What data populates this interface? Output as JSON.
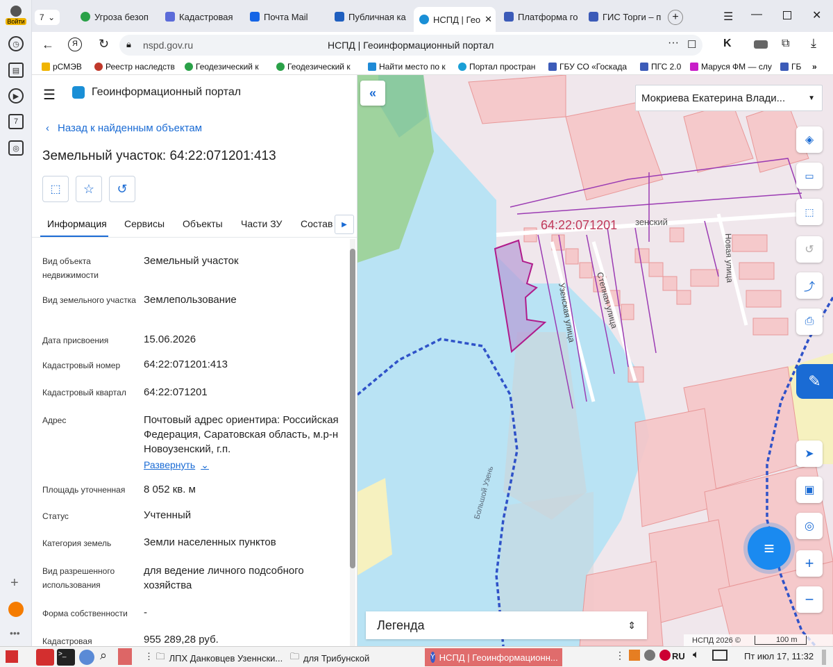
{
  "browser": {
    "profile_label": "Войти",
    "tab_count_badge": "7",
    "tabs": [
      {
        "title": "Угроза безоп",
        "color": "#2aa148"
      },
      {
        "title": "Кадастровая",
        "color": "#5b6bd9"
      },
      {
        "title": "Почта Mail",
        "color": "#1565e6"
      },
      {
        "title": "Публичная ка",
        "color": "#1f5fbf"
      },
      {
        "title": "НСПД | Гео",
        "color": "#1a8fd6"
      },
      {
        "title": "Платформа го",
        "color": "#3c5bb8"
      },
      {
        "title": "ГИС Торги – п",
        "color": "#3c5bb8"
      }
    ],
    "url": "nspd.gov.ru",
    "page_title": "НСПД | Геоинформационный портал",
    "bookmarks": [
      {
        "label": "рСМЭВ",
        "color": "#f0b400"
      },
      {
        "label": "Реестр наследств",
        "color": "#c0392b"
      },
      {
        "label": "Геодезический к",
        "color": "#2aa148"
      },
      {
        "label": "Геодезический к",
        "color": "#2aa148"
      },
      {
        "label": "Найти место по к",
        "color": "#1f8ad6"
      },
      {
        "label": "Портал простран",
        "color": "#1a9fd6"
      },
      {
        "label": "ГБУ СО «Госкада",
        "color": "#3c5bb8"
      },
      {
        "label": "ПГС 2.0",
        "color": "#3c5bb8"
      },
      {
        "label": "Маруся ФМ — слу",
        "color": "#c81ec8"
      },
      {
        "label": "ГБ",
        "color": "#3c5bb8"
      }
    ]
  },
  "portal": {
    "title": "Геоинформационный портал",
    "back_link": "Назад к найденным объектам",
    "object_title": "Земельный участок: 64:22:071201:413",
    "tabs": [
      "Информация",
      "Сервисы",
      "Объекты",
      "Части ЗУ",
      "Состав"
    ],
    "active_tab": "Информация",
    "fields": [
      {
        "label": "Вид объекта недвижимости",
        "value": "Земельный участок"
      },
      {
        "label": "Вид земельного участка",
        "value": "Землепользование"
      },
      {
        "label": "Дата присвоения",
        "value": "15.06.2026"
      },
      {
        "label": "Кадастровый номер",
        "value": "64:22:071201:413"
      },
      {
        "label": "Кадастровый квартал",
        "value": "64:22:071201"
      },
      {
        "label": "Адрес",
        "value": "Почтовый адрес ориентира: Российская Федерация, Саратовская область, м.р-н Новоузенский, г.п."
      },
      {
        "label": "Площадь уточненная",
        "value": "8 052 кв. м"
      },
      {
        "label": "Статус",
        "value": "Учтенный"
      },
      {
        "label": "Категория земель",
        "value": "Земли населенных пунктов"
      },
      {
        "label": "Вид разрешенного использования",
        "value": "для ведение личного подсобного хозяйства"
      },
      {
        "label": "Форма собственности",
        "value": "-"
      },
      {
        "label": "Кадастровая",
        "value": "955 289,28 руб."
      }
    ],
    "expand_link": "Развернуть"
  },
  "map": {
    "user_name": "Мокриева Екатерина Влади...",
    "quarter_label": "64:22:071201",
    "street_labels": [
      "Узенская улица",
      "Степная улица",
      "Новая улица",
      "зенский",
      "Большой Узень"
    ],
    "legend_label": "Легенда",
    "attribution": "НСПД 2026 ©",
    "scale_label": "100 m"
  },
  "taskbar": {
    "items": [
      "ЛПХ Данковцев Узеннски...",
      "для Трибунской",
      "НСПД | Геоинформационн..."
    ],
    "lang": "RU",
    "clock": "Пт июл 17, 11:32"
  }
}
